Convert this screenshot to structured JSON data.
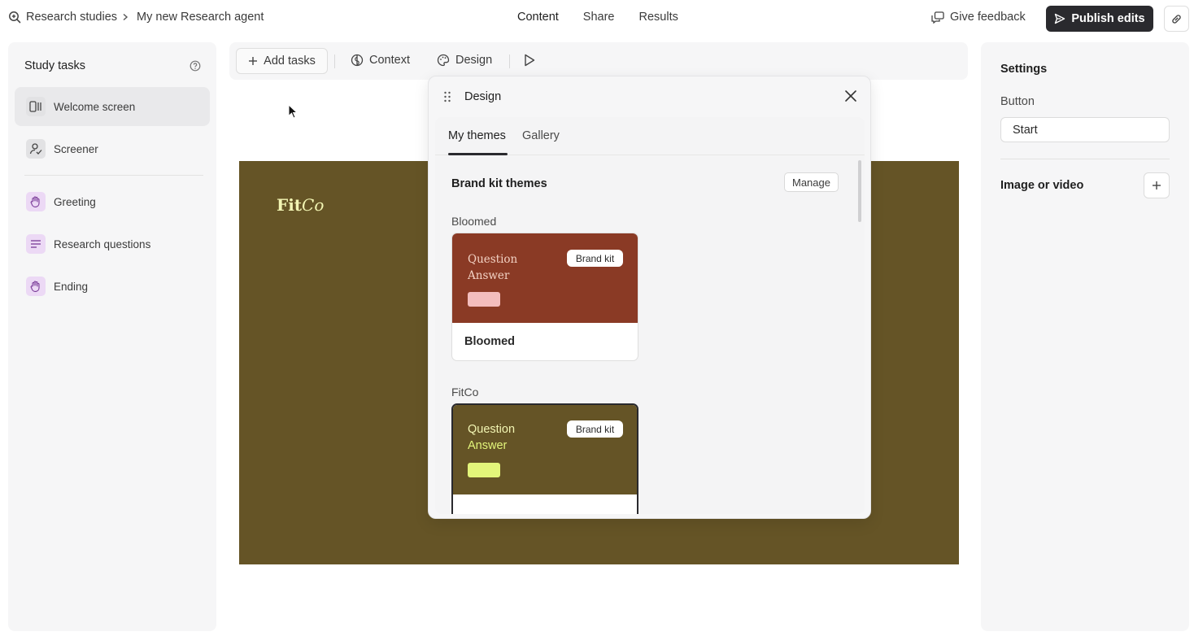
{
  "breadcrumb": {
    "root": "Research studies",
    "current": "My new Research agent"
  },
  "topnav": {
    "tabs": [
      "Content",
      "Share",
      "Results"
    ],
    "active": "Content"
  },
  "header_actions": {
    "feedback_label": "Give feedback",
    "publish_label": "Publish edits"
  },
  "sidebar": {
    "title": "Study tasks",
    "items": [
      {
        "label": "Welcome screen",
        "icon": "welcome-screen-icon",
        "selected": true
      },
      {
        "label": "Screener",
        "icon": "screener-icon",
        "selected": false
      },
      {
        "label": "Greeting",
        "icon": "greeting-icon",
        "selected": false
      },
      {
        "label": "Research questions",
        "icon": "research-questions-icon",
        "selected": false
      },
      {
        "label": "Ending",
        "icon": "ending-icon",
        "selected": false
      }
    ]
  },
  "toolbar": {
    "add_tasks": "Add tasks",
    "context": "Context",
    "design": "Design"
  },
  "canvas": {
    "logo_bold": "Fit",
    "logo_italic": "Co",
    "background": "#655426",
    "logo_color": "#f2f5b3"
  },
  "design_panel": {
    "title": "Design",
    "tabs": [
      "My themes",
      "Gallery"
    ],
    "active_tab": "My themes",
    "section_title": "Brand kit themes",
    "manage_label": "Manage",
    "groups": [
      {
        "label": "Bloomed",
        "theme": {
          "question": "Question",
          "answer": "Answer",
          "badge": "Brand kit",
          "name": "Bloomed",
          "bg": "#8a3a25",
          "text_color": "#f3d2c4",
          "button_color": "#f3bdbd"
        }
      },
      {
        "label": "FitCo",
        "theme": {
          "question": "Question",
          "answer": "Answer",
          "badge": "Brand kit",
          "name": "",
          "bg": "#655426",
          "text_color": "#f2f5b3",
          "button_color": "#e3f57a"
        }
      }
    ]
  },
  "settings": {
    "title": "Settings",
    "button_label": "Button",
    "button_value": "Start",
    "media_label": "Image or video"
  }
}
